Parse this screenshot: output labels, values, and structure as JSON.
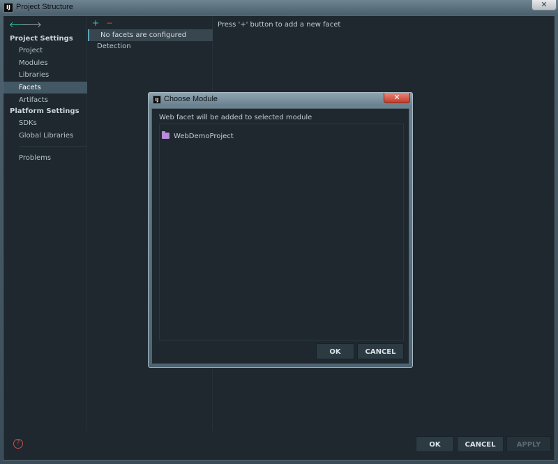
{
  "window": {
    "title": "Project Structure",
    "app_icon_text": "IJ",
    "close_glyph": "✕"
  },
  "nav": {
    "back_glyph": "🡐",
    "forward_glyph": "🡒",
    "project_settings_header": "Project Settings",
    "platform_settings_header": "Platform Settings",
    "items": [
      {
        "label": "Project"
      },
      {
        "label": "Modules"
      },
      {
        "label": "Libraries"
      },
      {
        "label": "Facets"
      },
      {
        "label": "Artifacts"
      },
      {
        "label": "SDKs"
      },
      {
        "label": "Global Libraries"
      },
      {
        "label": "Problems"
      }
    ]
  },
  "facets": {
    "add_glyph": "+",
    "remove_glyph": "−",
    "empty_row": "No facets are configured",
    "detection": "Detection",
    "hint": "Press '+' button to add a new facet"
  },
  "dialog": {
    "title": "Choose Module",
    "message": "Web facet will be added to selected module",
    "modules": [
      {
        "label": "WebDemoProject"
      }
    ],
    "ok_label": "OK",
    "cancel_label": "CANCEL"
  },
  "footer": {
    "help_glyph": "?",
    "ok_label": "OK",
    "cancel_label": "CANCEL",
    "apply_label": "APPLY"
  }
}
